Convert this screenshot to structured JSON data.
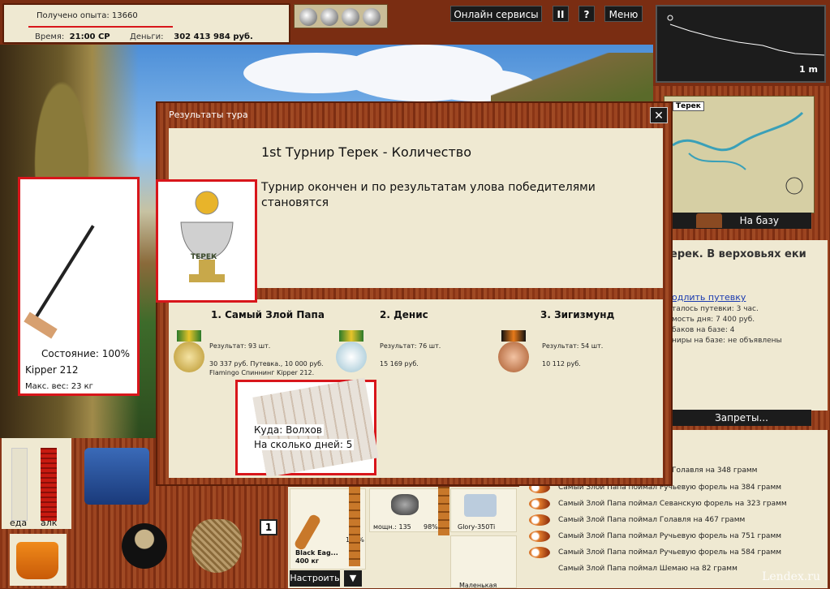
{
  "top_status": {
    "exp_label": "Получено опыта: 13660",
    "time_label": "Время:",
    "time_value": "21:00 СР",
    "money_label": "Деньги:",
    "money_value": "302 413 984 руб."
  },
  "top_buttons": {
    "online": "Онлайн сервисы",
    "pause": "II",
    "help": "?",
    "menu": "Меню"
  },
  "minimap": {
    "distance": "1 m"
  },
  "map": {
    "tag": "Терек",
    "to_base": "На базу"
  },
  "right_panel": {
    "heading": "ерек. В верховьях еки",
    "link": "одлить путевку",
    "lines": [
      "талось путевки: 3 час.",
      "мость дня: 7 400 руб.",
      "баков на базе: 4",
      "ниры на базе: не объявлены"
    ],
    "bans": "Запреты..."
  },
  "feed": [
    "Голавля на 348 грамм",
    "Самый Злой Папа поймал Ручьевую форель на 384 грамм",
    "Самый Злой Папа поймал Севанскую форель на 323 грамм",
    "Самый Злой Папа поймал Голавля на 467 грамм",
    "Самый Злой Папа поймал Ручьевую форель на 751 грамм",
    "Самый Злой Папа поймал Ручьевую форель на 584 грамм",
    "Самый Злой Папа поймал Шемаю на 82 грамм"
  ],
  "rod": {
    "state": "Состояние: 100%",
    "name": "Kipper 212",
    "max": "Макс. вес: 23 кг"
  },
  "meters": {
    "food": "еда",
    "alc": "алк"
  },
  "dialog": {
    "title": "Результаты тура",
    "close": "✕",
    "heading": "1st Турнир Терек - Количество",
    "message": "Турнир окончен и по результатам улова победителями становятся",
    "trophy_text": "ТЕРЕК",
    "winners": [
      {
        "place": "1. Самый Злой Папа",
        "result": "Результат: 93 шт.",
        "prize": "30 337 руб. Путевка., 10 000 руб. Flamingo Спиннинг Kipper 212."
      },
      {
        "place": "2. Денис",
        "result": "Результат: 76 шт.",
        "prize": "15 169 руб."
      },
      {
        "place": "3. Зигизмунд",
        "result": "Результат: 54 шт.",
        "prize": "10 112 руб."
      }
    ],
    "ticket": {
      "where": "Куда: Волхов",
      "days": "На сколько дней:  5"
    }
  },
  "tools": {
    "lure_name": "Black Eag...",
    "lure_weight": "400 кг",
    "lure_pct": "100%",
    "reel_info": "мощн.: 135",
    "reel_pct": "98%",
    "line_name": "Glory-350Ti",
    "bait": "Маленькая",
    "settings": "Настроить",
    "arrow": "▼"
  },
  "badge": "1",
  "watermark": "Lendex.ru"
}
